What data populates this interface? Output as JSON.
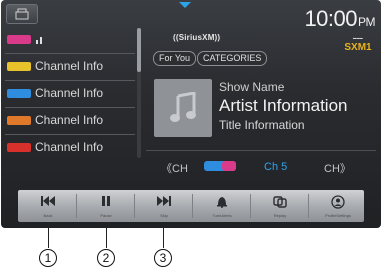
{
  "clock": {
    "time": "10:00",
    "ampm": "PM"
  },
  "channel_list": {
    "items": [
      {
        "label": "",
        "logo_color": "#d93a8a",
        "icon": "signal-bars-icon"
      },
      {
        "label": "Channel Info",
        "logo_color": "#e8c22a"
      },
      {
        "label": "Channel Info",
        "logo_color": "#2f8de0"
      },
      {
        "label": "Channel Info",
        "logo_color": "#e07a2a"
      },
      {
        "label": "Channel Info",
        "logo_color": "#d8302a"
      }
    ]
  },
  "source": {
    "brand": "((SiriusXM))",
    "preset_badge": "SXM1"
  },
  "filters": {
    "for_you": "For You",
    "categories": "CATEGORIES"
  },
  "now_playing": {
    "show_name": "Show Name",
    "artist": "Artist Information",
    "title": "Title Information"
  },
  "channel_strip": {
    "prev": "CH",
    "channel": "Ch 5",
    "next": "CH"
  },
  "controls": [
    {
      "label": "Back",
      "icon": "skip-back-icon"
    },
    {
      "label": "Pause",
      "icon": "pause-icon"
    },
    {
      "label": "Skip",
      "icon": "skip-forward-icon"
    },
    {
      "label": "TuneAlerts",
      "icon": "bell-icon"
    },
    {
      "label": "Replay",
      "icon": "replay-icon"
    },
    {
      "label": "ProfileSettings",
      "icon": "profile-icon"
    }
  ],
  "callouts": [
    "1",
    "2",
    "3"
  ],
  "colors": {
    "accent": "#2fa3e8",
    "badge": "#e9b21d"
  }
}
